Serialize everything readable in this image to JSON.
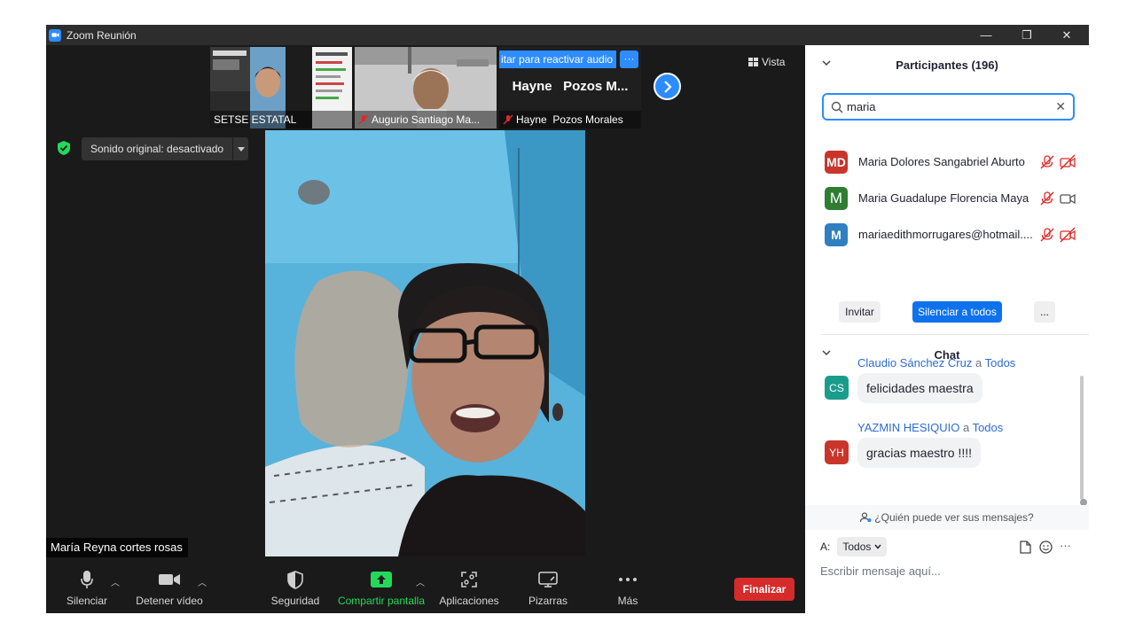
{
  "window": {
    "title": "Zoom Reunión",
    "minimize": "—",
    "restore": "❐",
    "close": "✕"
  },
  "stage": {
    "thumbnails": [
      {
        "name": "SETSE ESTATAL",
        "muted": false
      },
      {
        "name": "Augurio Santiago Ma...",
        "muted": true
      },
      {
        "name": "Hayne  Pozos Morales",
        "muted": true,
        "banner": "itar para reactivar audio",
        "big_name": "Hayne   Pozos M...",
        "more": "···"
      }
    ],
    "view_label": "Vista",
    "original_sound": "Sonido original: desactivado",
    "active_speaker": "María Reyna cortes rosas"
  },
  "toolbar": {
    "mute": "Silenciar",
    "stop_video": "Detener vídeo",
    "security": "Seguridad",
    "share": "Compartir pantalla",
    "apps": "Aplicaciones",
    "boards": "Pizarras",
    "more": "Más",
    "end": "Finalizar",
    "colors": {
      "share_green": "#23d959",
      "end_red": "#d52b2b"
    }
  },
  "participants": {
    "title": "Participantes (196)",
    "search_value": "maria",
    "list": [
      {
        "initials": "MD",
        "name": "Maria Dolores Sangabriel Aburto",
        "color": "#c9352b",
        "video_off": true
      },
      {
        "initials": "M",
        "name": "Maria Guadalupe Florencia Maya",
        "color": "#2e7d32",
        "video_off": false
      },
      {
        "initials": "M",
        "name": "mariaedithmorrugares@hotmail....",
        "color": "#2f7fc1",
        "video_off": true
      }
    ],
    "invite": "Invitar",
    "mute_all": "Silenciar a todos",
    "more": "..."
  },
  "chat": {
    "title": "Chat",
    "connector": "a",
    "messages": [
      {
        "initials": "CS",
        "color": "#1a9c8c",
        "sender": "Claudio Sánchez Cruz",
        "to": "Todos",
        "text": "felicidades maestra"
      },
      {
        "initials": "YH",
        "color": "#c9352b",
        "sender": "YAZMIN HESIQUIO",
        "to": "Todos",
        "text": "gracias maestro !!!!"
      }
    ],
    "who_sees": "¿Quién puede ver sus mensajes?",
    "to_label": "A:",
    "to_value": "Todos",
    "more": "···",
    "placeholder": "Escribir mensaje aquí..."
  }
}
